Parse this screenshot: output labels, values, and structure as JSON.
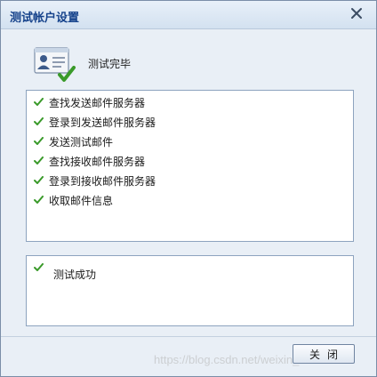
{
  "window": {
    "title": "测试帐户设置"
  },
  "header": {
    "status_heading": "测试完毕"
  },
  "steps": [
    {
      "label": "查找发送邮件服务器"
    },
    {
      "label": "登录到发送邮件服务器"
    },
    {
      "label": "发送测试邮件"
    },
    {
      "label": "查找接收邮件服务器"
    },
    {
      "label": "登录到接收邮件服务器"
    },
    {
      "label": "收取邮件信息"
    }
  ],
  "result": {
    "label": "测试成功"
  },
  "footer": {
    "close_label": "关闭"
  },
  "watermark": {
    "text": "https://blog.csdn.net/weixin_43241769"
  },
  "colors": {
    "title_text": "#15428b",
    "check_green": "#3a9a2a",
    "panel_border": "#8da3bf",
    "window_bg": "#e9eff6"
  },
  "icons": {
    "close": "close-icon",
    "account_card": "account-card-icon",
    "check": "check-icon"
  }
}
